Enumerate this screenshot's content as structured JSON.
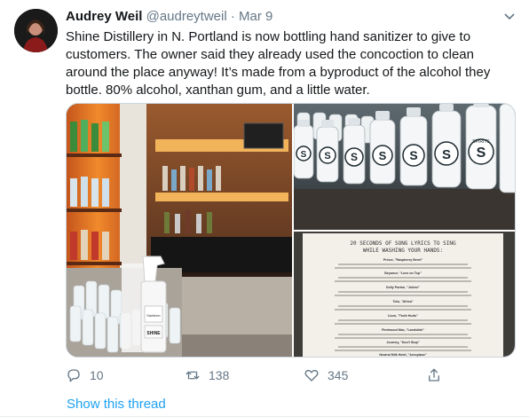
{
  "author": {
    "name": "Audrey Weil",
    "handle": "@audreytweil",
    "separator": "·",
    "date": "Mar 9"
  },
  "tweet_text": "Shine Distillery in N. Portland is now bottling hand sanitizer to give to customers. The owner said they already used the concoction to clean around the place anyway! It’s made from a byproduct of the alcohol they bottle. 80% alcohol, xanthan gum, and a little water.",
  "images": {
    "bar": {
      "spray_label": "Sanitizer",
      "bottle_label": "SHINE"
    },
    "bottles": {
      "label": "SPIRITS"
    },
    "flyer": {
      "title": "20 SECONDS OF SONG LYRICS TO SING",
      "subtitle": "WHILE WASHING YOUR HANDS:",
      "sections": [
        "Prince, \"Raspberry Beret\"",
        "Beyonce, \"Love on Top\"",
        "Dolly Parton, \"Jolene\"",
        "Toto, \"Africa\"",
        "Lizzo, \"Truth Hurts\"",
        "Fleetwood Mac, \"Landslide\"",
        "Journey, \"Don't Stop\"",
        "Neutral Milk Hotel, \"Aeroplane\""
      ]
    }
  },
  "actions": {
    "reply": {
      "icon": "reply-icon",
      "count": "10"
    },
    "retweet": {
      "icon": "retweet-icon",
      "count": "138"
    },
    "like": {
      "icon": "heart-icon",
      "count": "345"
    },
    "share": {
      "icon": "share-icon"
    }
  },
  "show_thread": "Show this thread",
  "colors": {
    "link": "#1da1f2",
    "muted": "#657786",
    "text": "#14171a"
  }
}
